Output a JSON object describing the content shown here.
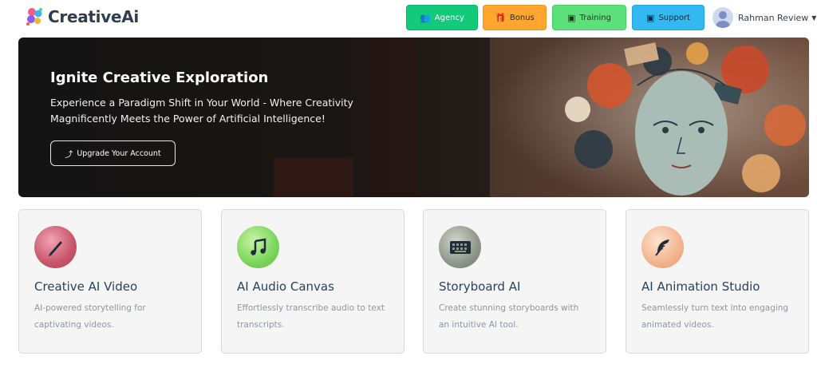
{
  "brand": {
    "name": "CreativeAi"
  },
  "nav": {
    "agency": "Agency",
    "bonus": "Bonus",
    "training": "Training",
    "support": "Support"
  },
  "user": {
    "name": "Rahman Review"
  },
  "hero": {
    "title": "Ignite Creative Exploration",
    "subtitle": "Experience a Paradigm Shift in Your World - Where Creativity Magnificently Meets the Power of Artificial Intelligence!",
    "button": "Upgrade Your Account"
  },
  "cards": [
    {
      "title": "Creative AI Video",
      "description": "AI-powered storytelling for captivating videos.",
      "icon": "pen-icon"
    },
    {
      "title": "AI Audio Canvas",
      "description": "Effortlessly transcribe audio to text transcripts.",
      "icon": "music-note-icon"
    },
    {
      "title": "Storyboard AI",
      "description": "Create stunning storyboards with an intuitive AI tool.",
      "icon": "keyboard-icon"
    },
    {
      "title": "AI Animation Studio",
      "description": "Seamlessly turn text into engaging animated videos.",
      "icon": "feather-icon"
    }
  ],
  "colors": {
    "agency": "#13c97a",
    "bonus": "#ffa62e",
    "training": "#5ce17a",
    "support": "#33b8f2",
    "card_title": "#27435c"
  }
}
